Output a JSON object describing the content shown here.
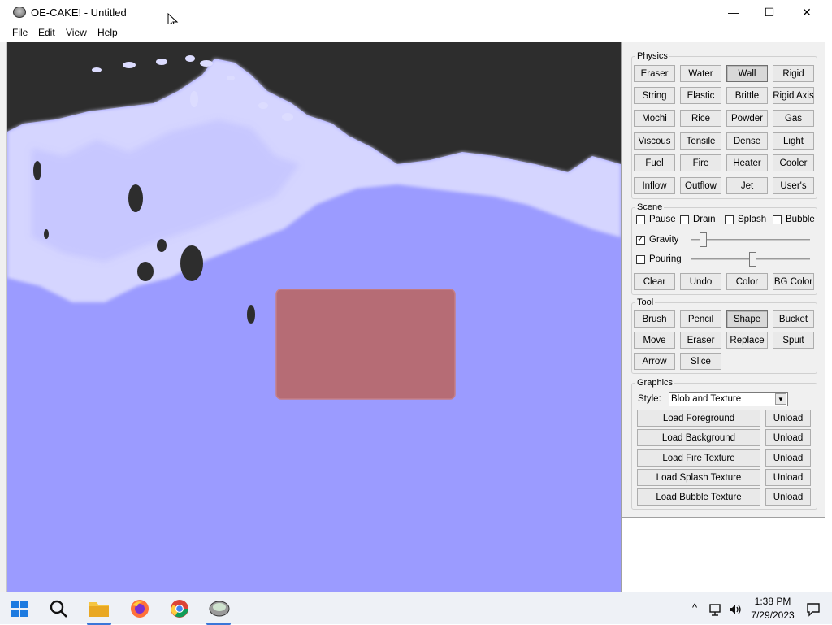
{
  "window": {
    "title": "OE-CAKE! - Untitled",
    "minimize_glyph": "—",
    "maximize_glyph": "☐",
    "close_glyph": "✕"
  },
  "menu": [
    "File",
    "Edit",
    "View",
    "Help"
  ],
  "colors": {
    "liquid": "#9b9bff",
    "wall_block": "#b86a6e",
    "background": "#2d2d2d",
    "foam": "#dcdcff"
  },
  "physics": {
    "title": "Physics",
    "buttons": [
      "Eraser",
      "Water",
      "Wall",
      "Rigid",
      "String",
      "Elastic",
      "Brittle",
      "Rigid Axis",
      "Mochi",
      "Rice",
      "Powder",
      "Gas",
      "Viscous",
      "Tensile",
      "Dense",
      "Light",
      "Fuel",
      "Fire",
      "Heater",
      "Cooler",
      "Inflow",
      "Outflow",
      "Jet",
      "User's"
    ],
    "active": "Wall"
  },
  "scene": {
    "title": "Scene",
    "checks": [
      {
        "label": "Pause",
        "checked": false
      },
      {
        "label": "Drain",
        "checked": false
      },
      {
        "label": "Splash",
        "checked": false
      },
      {
        "label": "Bubble",
        "checked": false
      }
    ],
    "gravity": {
      "label": "Gravity",
      "checked": true,
      "check_glyph": "✓",
      "level": 0.08
    },
    "pouring": {
      "label": "Pouring",
      "checked": false,
      "level": 0.52
    },
    "buttons": [
      "Clear",
      "Undo",
      "Color",
      "BG Color"
    ]
  },
  "tool": {
    "title": "Tool",
    "buttons": [
      "Brush",
      "Pencil",
      "Shape",
      "Bucket",
      "Move",
      "Eraser",
      "Replace",
      "Spuit",
      "Arrow",
      "Slice"
    ],
    "active": "Shape"
  },
  "graphics": {
    "title": "Graphics",
    "style_label": "Style:",
    "style_value": "Blob and Texture",
    "rows": [
      {
        "load": "Load Foreground",
        "unload": "Unload"
      },
      {
        "load": "Load Background",
        "unload": "Unload"
      },
      {
        "load": "Load Fire Texture",
        "unload": "Unload"
      },
      {
        "load": "Load Splash Texture",
        "unload": "Unload"
      },
      {
        "load": "Load Bubble Texture",
        "unload": "Unload"
      }
    ]
  },
  "taskbar": {
    "icons": [
      "windows-start-icon",
      "search-icon",
      "file-explorer-icon",
      "firefox-icon",
      "chrome-icon",
      "oe-cake-icon"
    ],
    "tray_chevron": "^",
    "time": "1:38 PM",
    "date": "7/29/2023"
  }
}
